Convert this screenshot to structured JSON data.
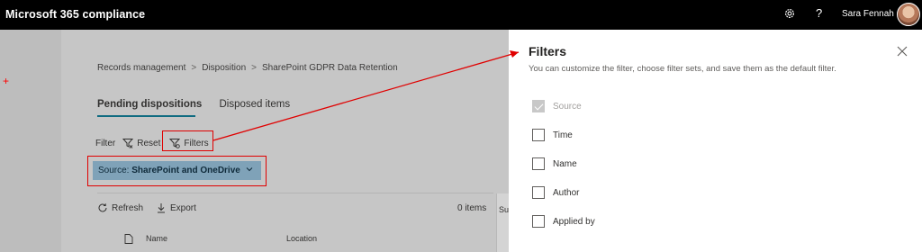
{
  "app": {
    "title": "Microsoft 365 compliance",
    "user_name": "Sara Fennah",
    "help_glyph": "?"
  },
  "breadcrumb": {
    "items": [
      "Records management",
      "Disposition",
      "SharePoint GDPR Data Retention"
    ],
    "separator": ">"
  },
  "tabs": [
    {
      "label": "Pending dispositions",
      "active": true
    },
    {
      "label": "Disposed items",
      "active": false
    }
  ],
  "filter_bar": {
    "label": "Filter",
    "reset_label": "Reset",
    "filters_label": "Filters"
  },
  "source_pill": {
    "prefix": "Source:",
    "value": "SharePoint and OneDrive"
  },
  "toolbar": {
    "refresh_label": "Refresh",
    "export_label": "Export",
    "items_count": "0 items"
  },
  "table": {
    "columns": [
      "Name",
      "Location"
    ]
  },
  "side_card": {
    "text": "Su"
  },
  "filters_panel": {
    "title": "Filters",
    "subtitle": "You can customize the filter, choose filter sets, and save them as the default filter.",
    "options": [
      {
        "label": "Source",
        "checked": true,
        "disabled": true
      },
      {
        "label": "Time",
        "checked": false,
        "disabled": false
      },
      {
        "label": "Name",
        "checked": false,
        "disabled": false
      },
      {
        "label": "Author",
        "checked": false,
        "disabled": false
      },
      {
        "label": "Applied by",
        "checked": false,
        "disabled": false
      }
    ]
  },
  "colors": {
    "accent": "#0f6b81",
    "annotation": "#e00000",
    "pill": "#7fa2b8"
  }
}
